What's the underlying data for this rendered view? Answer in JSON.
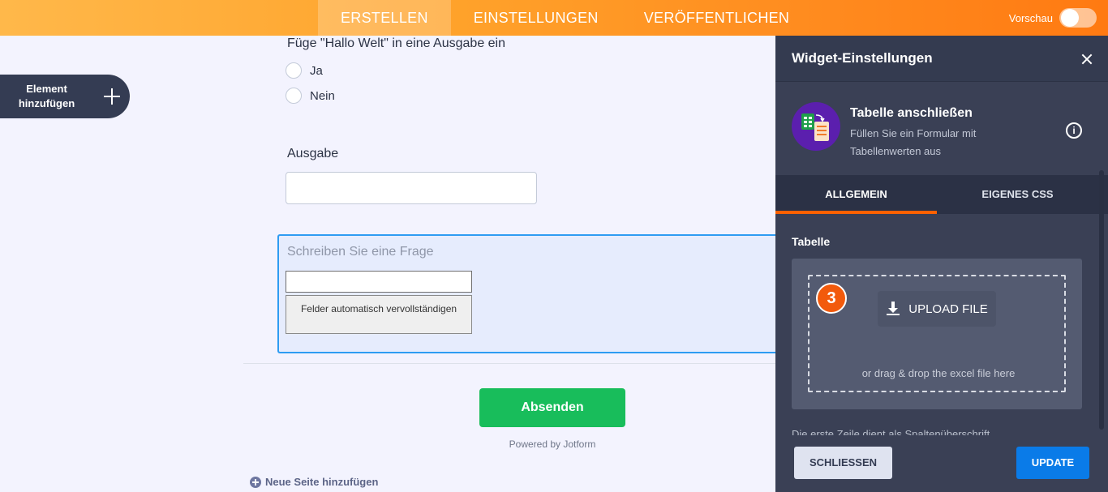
{
  "topbar": {
    "tabs": [
      {
        "label": "ERSTELLEN",
        "active": true
      },
      {
        "label": "EINSTELLUNGEN",
        "active": false
      },
      {
        "label": "VERÖFFENTLICHEN",
        "active": false
      }
    ],
    "preview_label": "Vorschau",
    "preview_on": false
  },
  "sidebar": {
    "add_element_label": "Element hinzufügen"
  },
  "form": {
    "question_title": "Füge \"Hallo Welt\" in eine Ausgabe ein",
    "options": [
      "Ja",
      "Nein"
    ],
    "output_label": "Ausgabe",
    "output_value": "",
    "selected_question_placeholder": "Schreiben Sie eine Frage",
    "autofill_button": "Felder automatisch vervollständigen",
    "submit_label": "Absenden",
    "powered_by": "Powered by Jotform",
    "new_page_label": "Neue Seite hinzufügen"
  },
  "panel": {
    "title": "Widget-Einstellungen",
    "widget_name": "Tabelle anschließen",
    "widget_description": "Füllen Sie ein Formular mit Tabellenwerten aus",
    "tabs": [
      "ALLGEMEIN",
      "EIGENES CSS"
    ],
    "section_label": "Tabelle",
    "step_badge": "3",
    "upload_label": "UPLOAD FILE",
    "drag_hint": "or drag & drop the excel file here",
    "row_note": "Die erste Zeile dient als Spaltenüberschrift",
    "close_label": "SCHLIESSEN",
    "update_label": "UPDATE"
  },
  "colors": {
    "topbar_start": "#ffb84a",
    "topbar_end": "#ff7a12",
    "panel_bg": "#3a4055",
    "submit_green": "#18bd5b",
    "update_blue": "#0a7be8",
    "active_tab_orange": "#ff6100",
    "badge_orange": "#f25a0c",
    "selection_blue": "#2e9cf2"
  },
  "icons": {
    "close": "close-icon",
    "info": "info-icon",
    "upload": "download-icon",
    "add": "plus-icon",
    "widget": "spreadsheet-icon"
  }
}
